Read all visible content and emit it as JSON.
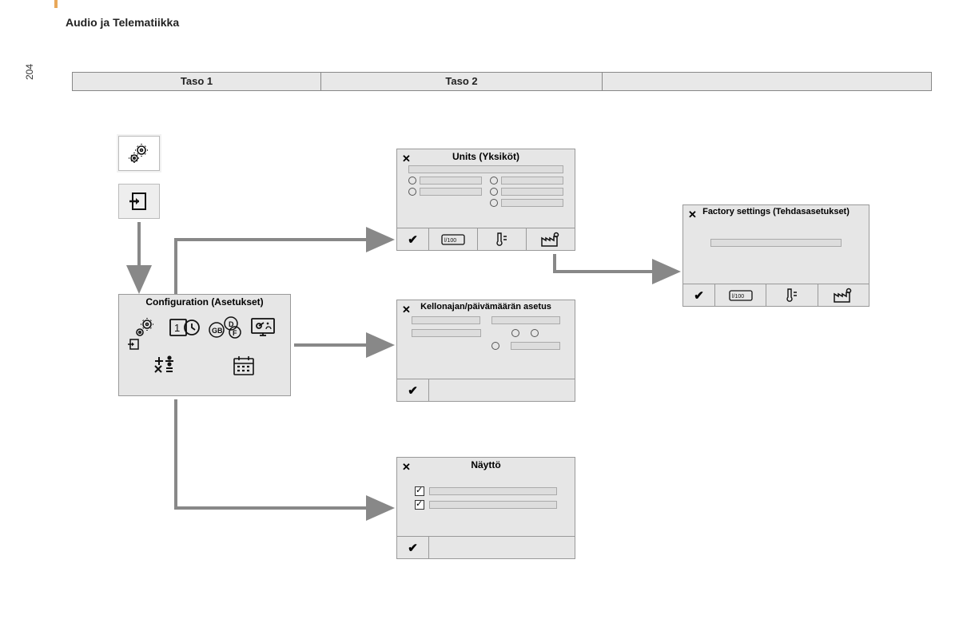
{
  "page": {
    "title": "Audio ja Telematiikka",
    "number": "204"
  },
  "levels": {
    "l1": "Taso 1",
    "l2": "Taso 2",
    "l3": ""
  },
  "panels": {
    "config": {
      "title": "Configuration (Asetukset)"
    },
    "units": {
      "title": "Units (Yksiköt)"
    },
    "datetime": {
      "title": "Kellonajan/päivämäärän asetus"
    },
    "display": {
      "title": "Näyttö"
    },
    "factory": {
      "title": "Factory settings (Tehdasasetukset)"
    }
  }
}
